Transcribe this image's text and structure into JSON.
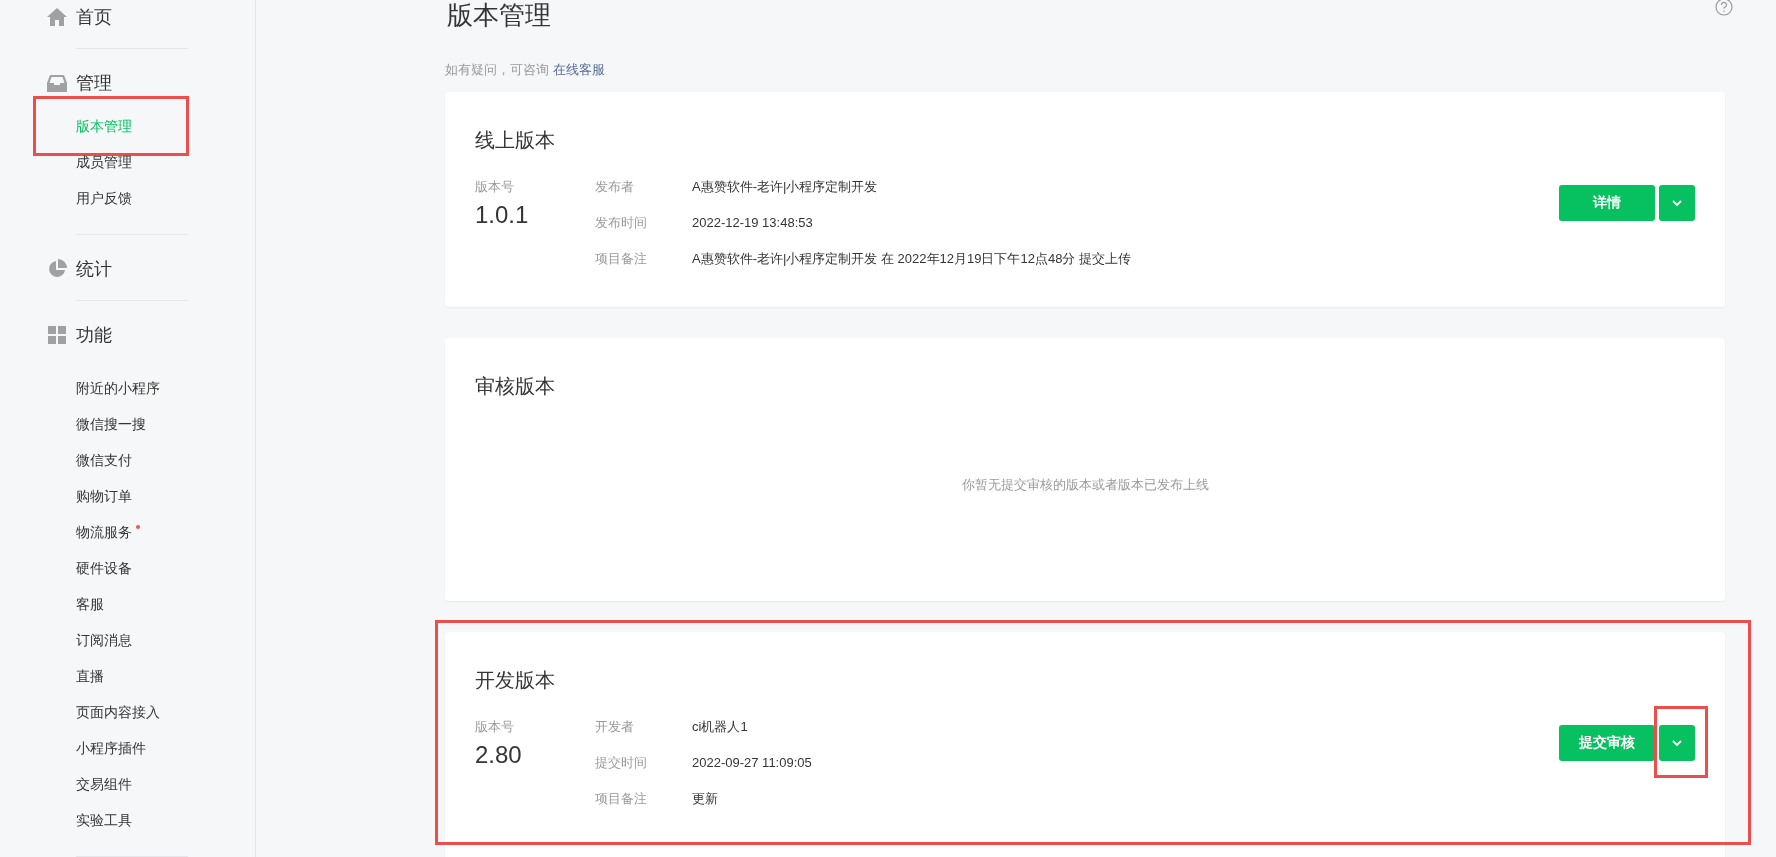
{
  "sidebar": {
    "sections": [
      {
        "kind": "home",
        "label": "首页"
      },
      {
        "kind": "manage",
        "label": "管理",
        "items": [
          {
            "label": "版本管理",
            "selected": true,
            "dot": false
          },
          {
            "label": "成员管理",
            "selected": false,
            "dot": false
          },
          {
            "label": "用户反馈",
            "selected": false,
            "dot": false
          }
        ]
      },
      {
        "kind": "stats",
        "label": "统计"
      },
      {
        "kind": "features",
        "label": "功能",
        "items": [
          {
            "label": "附近的小程序",
            "selected": false,
            "dot": false
          },
          {
            "label": "微信搜一搜",
            "selected": false,
            "dot": false
          },
          {
            "label": "微信支付",
            "selected": false,
            "dot": false
          },
          {
            "label": "购物订单",
            "selected": false,
            "dot": false
          },
          {
            "label": "物流服务",
            "selected": false,
            "dot": true
          },
          {
            "label": "硬件设备",
            "selected": false,
            "dot": false
          },
          {
            "label": "客服",
            "selected": false,
            "dot": false
          },
          {
            "label": "订阅消息",
            "selected": false,
            "dot": false
          },
          {
            "label": "直播",
            "selected": false,
            "dot": false
          },
          {
            "label": "页面内容接入",
            "selected": false,
            "dot": false
          },
          {
            "label": "小程序插件",
            "selected": false,
            "dot": false
          },
          {
            "label": "交易组件",
            "selected": false,
            "dot": false
          },
          {
            "label": "实验工具",
            "selected": false,
            "dot": false
          }
        ]
      }
    ]
  },
  "page": {
    "title": "版本管理",
    "help_text": "如有疑问，可咨询",
    "help_link": "在线客服"
  },
  "cards": [
    {
      "title": "线上版本",
      "version_label": "版本号",
      "version": "1.0.1",
      "fields": [
        {
          "label": "发布者",
          "value": "A惠赞软件-老许|小程序定制开发"
        },
        {
          "label": "发布时间",
          "value": "2022-12-19 13:48:53"
        },
        {
          "label": "项目备注",
          "value": "A惠赞软件-老许|小程序定制开发 在 2022年12月19日下午12点48分 提交上传"
        }
      ],
      "primary_button": "详情",
      "highlighted": false
    },
    {
      "title": "审核版本",
      "empty_message": "你暂无提交审核的版本或者版本已发布上线",
      "highlighted": false
    },
    {
      "title": "开发版本",
      "version_label": "版本号",
      "version": "2.80",
      "fields": [
        {
          "label": "开发者",
          "value": "ci机器人1"
        },
        {
          "label": "提交时间",
          "value": "2022-09-27 11:09:05"
        },
        {
          "label": "项目备注",
          "value": "更新"
        }
      ],
      "primary_button": "提交审核",
      "highlighted": true,
      "dropdown_highlighted": true
    }
  ]
}
